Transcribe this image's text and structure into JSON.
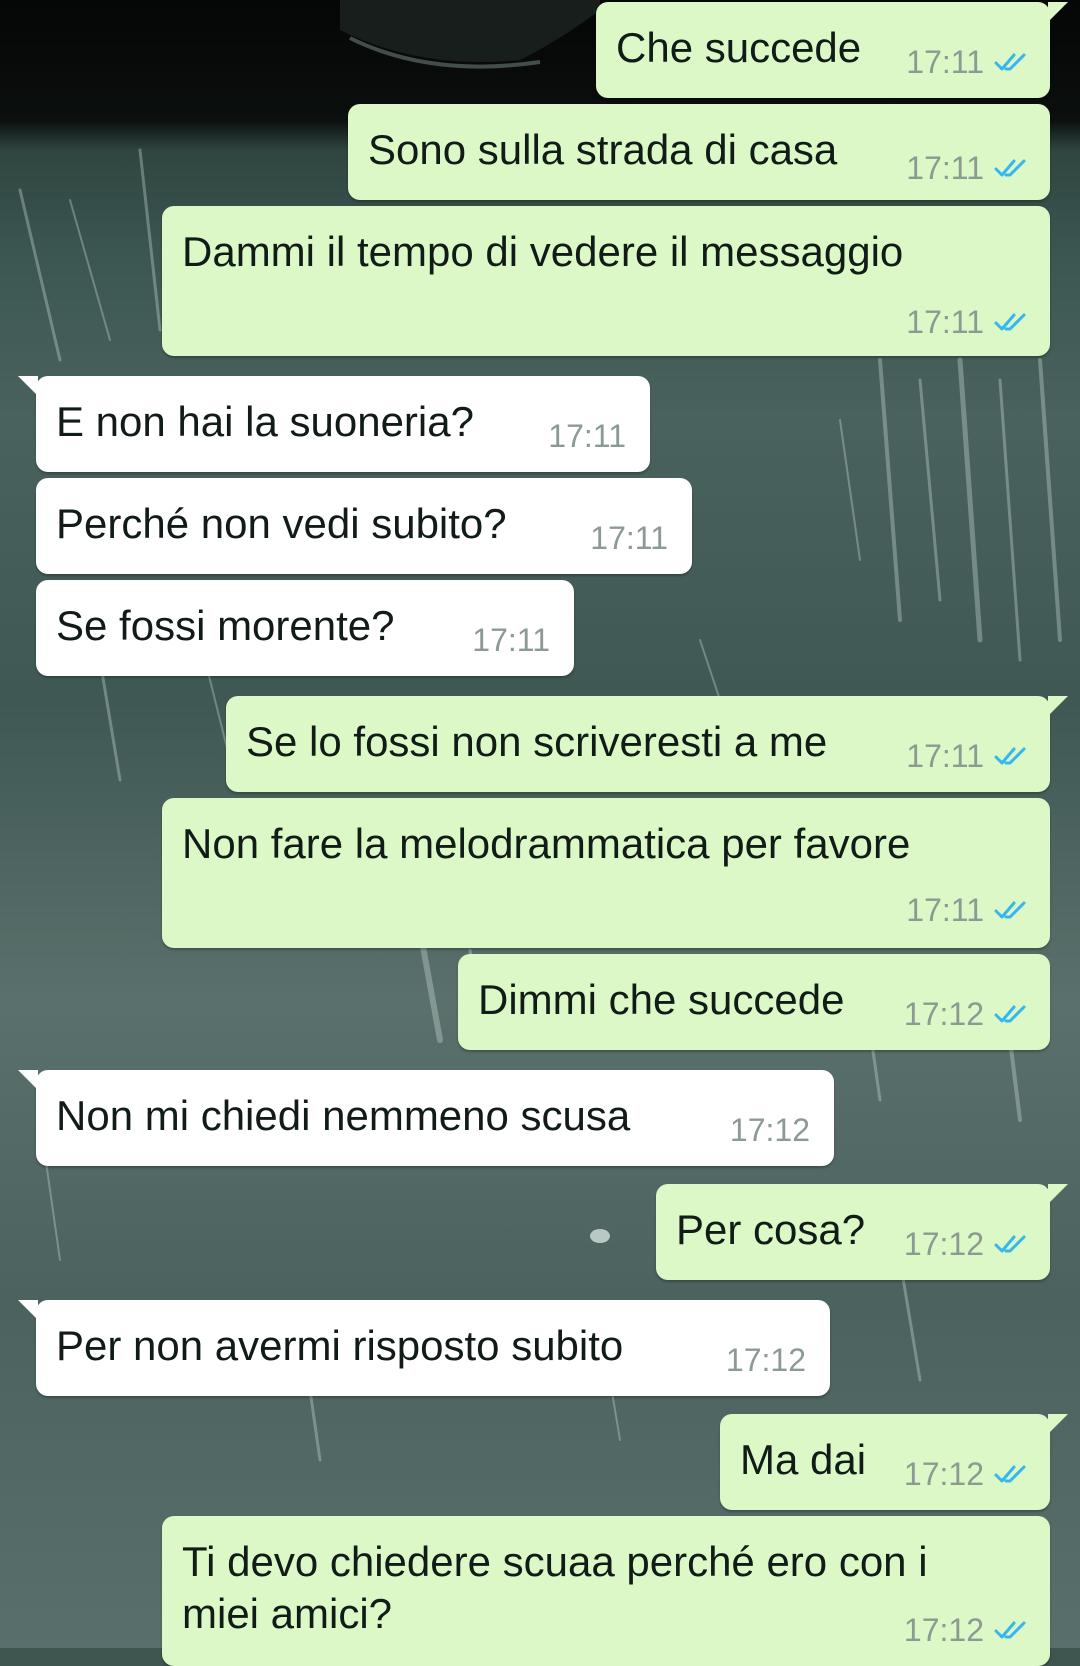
{
  "conversation": {
    "messages": [
      {
        "direction": "out",
        "text": "Che succede",
        "time": "17:11",
        "status": "read"
      },
      {
        "direction": "out",
        "text": "Sono sulla strada di casa",
        "time": "17:11",
        "status": "read"
      },
      {
        "direction": "out",
        "text": "Dammi il tempo di vedere il messaggio",
        "time": "17:11",
        "status": "read"
      },
      {
        "direction": "in",
        "text": "E non hai la suoneria?",
        "time": "17:11"
      },
      {
        "direction": "in",
        "text": "Perché non vedi subito?",
        "time": "17:11"
      },
      {
        "direction": "in",
        "text": "Se fossi morente?",
        "time": "17:11"
      },
      {
        "direction": "out",
        "text": "Se lo fossi non scriveresti a me",
        "time": "17:11",
        "status": "read"
      },
      {
        "direction": "out",
        "text": "Non fare la melodrammatica per favore",
        "time": "17:11",
        "status": "read"
      },
      {
        "direction": "out",
        "text": "Dimmi che succede",
        "time": "17:12",
        "status": "read"
      },
      {
        "direction": "in",
        "text": "Non mi chiedi nemmeno scusa",
        "time": "17:12"
      },
      {
        "direction": "out",
        "text": "Per cosa?",
        "time": "17:12",
        "status": "read"
      },
      {
        "direction": "in",
        "text": "Per non avermi risposto subito",
        "time": "17:12"
      },
      {
        "direction": "out",
        "text": "Ma dai",
        "time": "17:12",
        "status": "read"
      },
      {
        "direction": "out",
        "text_line1": "Ti devo chiedere scuaa perché ero con i",
        "text_line2": "miei amici?",
        "time": "17:12",
        "status": "read"
      }
    ]
  },
  "icons": {
    "read_receipt": "double-check-icon"
  },
  "colors": {
    "outgoing_bubble": "#dcf8c6",
    "incoming_bubble": "#ffffff",
    "read_tick": "#34b7f1",
    "timestamp": "#8b9a93"
  }
}
